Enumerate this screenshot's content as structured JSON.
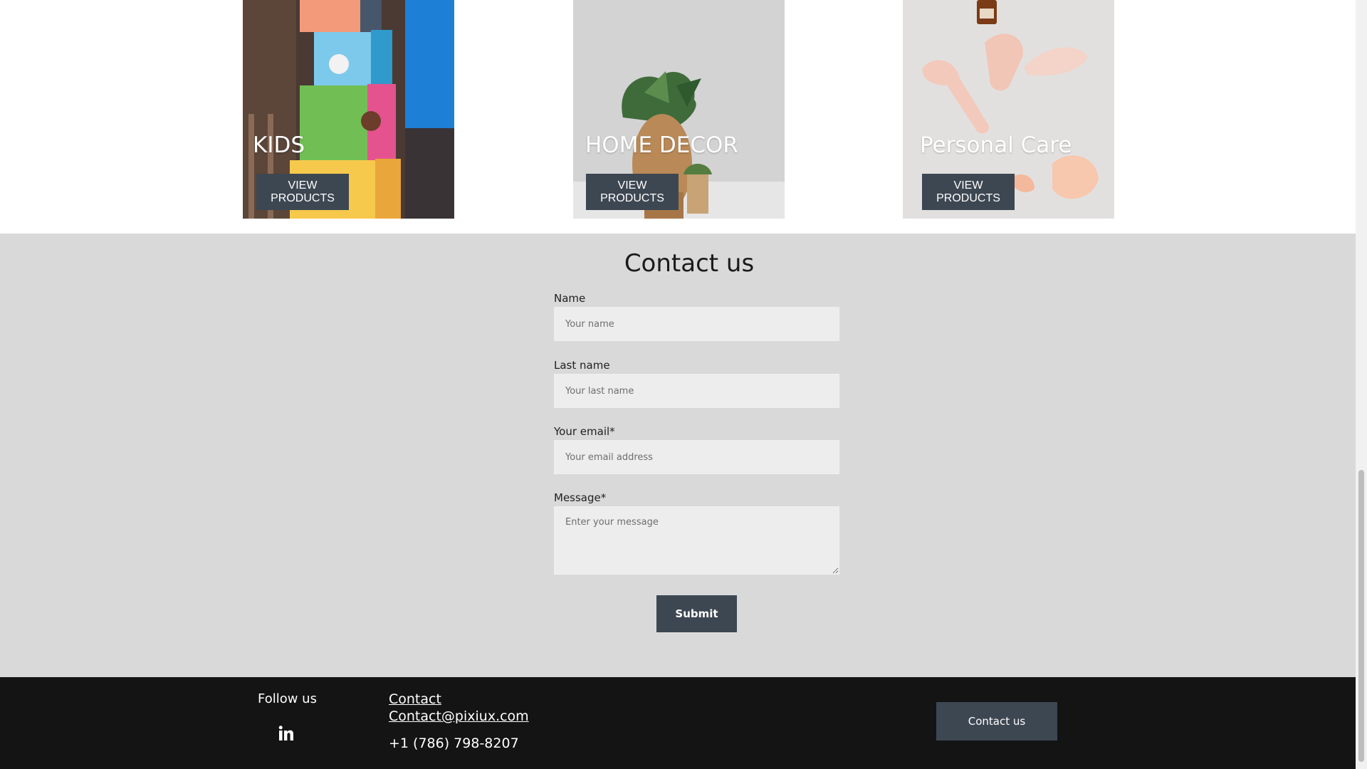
{
  "categories": [
    {
      "title": "KIDS",
      "button_label": "VIEW PRODUCTS"
    },
    {
      "title": "HOME DECOR",
      "button_label": "VIEW PRODUCTS"
    },
    {
      "title": "Personal Care",
      "button_label": "VIEW PRODUCTS"
    }
  ],
  "contact_form": {
    "heading": "Contact us",
    "name_label": "Name",
    "name_placeholder": "Your name",
    "last_name_label": "Last name",
    "last_name_placeholder": "Your last name",
    "email_label": "Your email*",
    "email_placeholder": "Your email address",
    "message_label": "Message*",
    "message_placeholder": "Enter your message",
    "submit_label": "Submit"
  },
  "footer": {
    "follow_label": "Follow us",
    "social_icon": "linkedin-icon",
    "contact_link": "Contact",
    "email_link": "Contact@pixiux.com",
    "phone": "+1 (786) 798-8207",
    "contact_button": "Contact us"
  },
  "colors": {
    "button_bg": "#3d4752",
    "section_bg": "#d9d9d9",
    "footer_bg": "#141414",
    "input_bg": "#ededed"
  }
}
